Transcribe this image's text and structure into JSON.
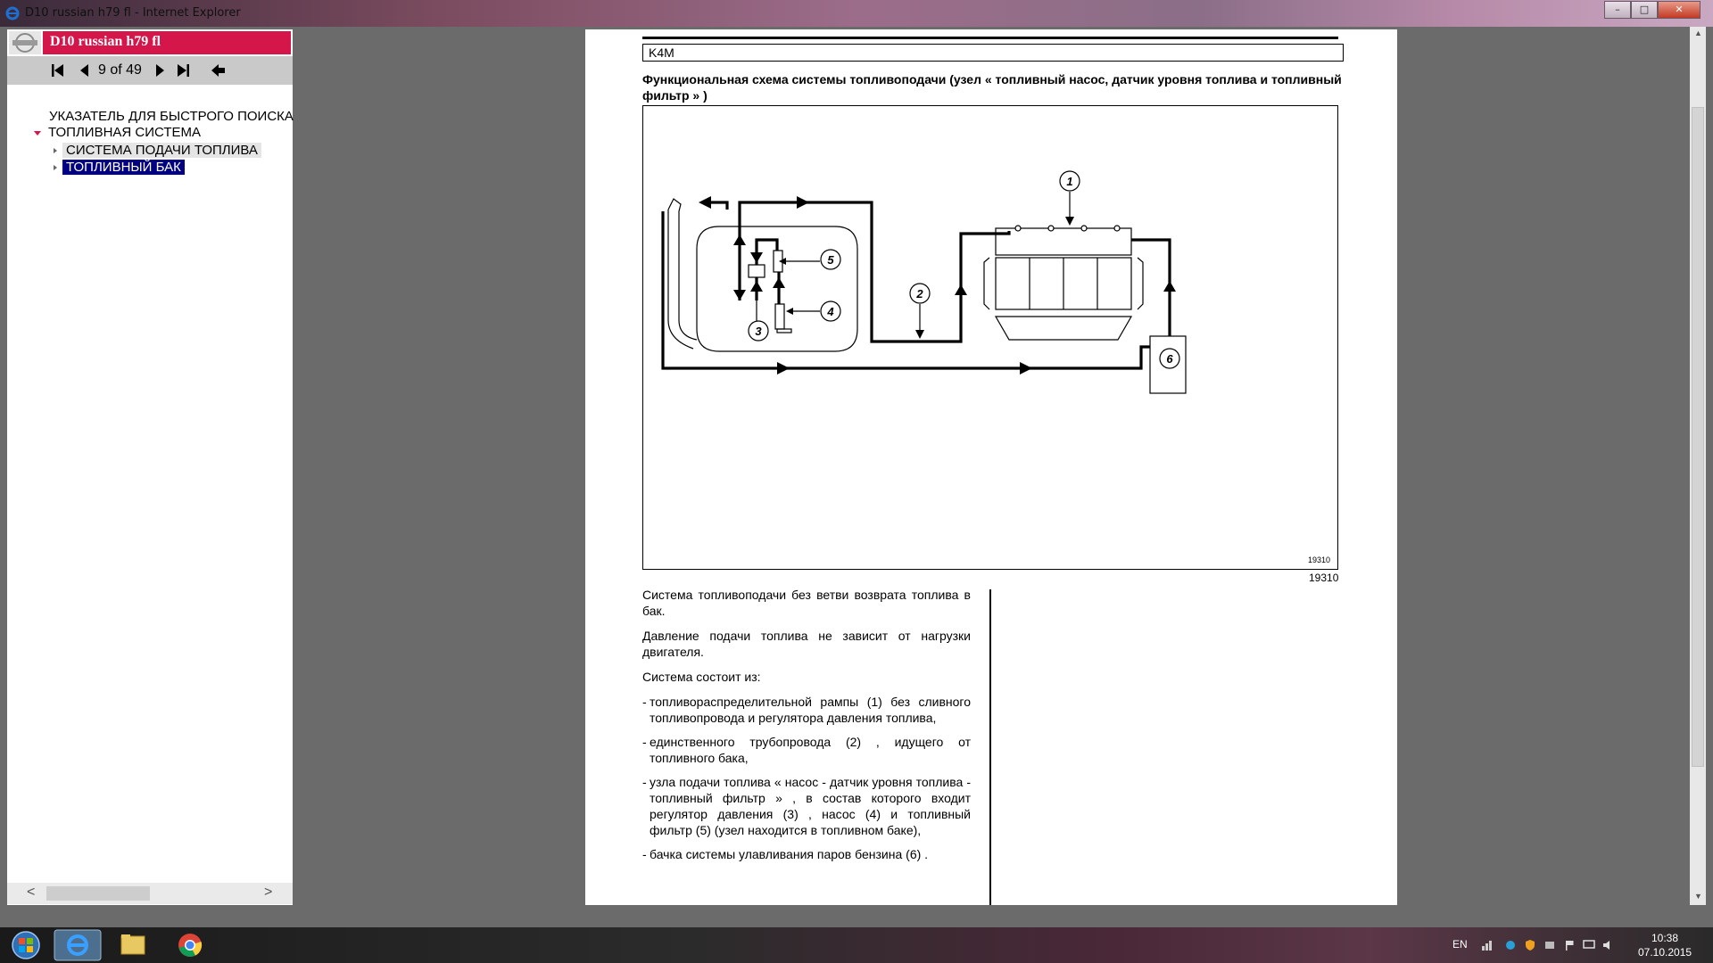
{
  "window": {
    "title": "D10 russian h79 fl - Internet Explorer"
  },
  "app": {
    "title": "D10 russian h79 fl",
    "pagination": {
      "current": 9,
      "total": 49,
      "label": "9 of 49"
    }
  },
  "toc": {
    "items": [
      {
        "label": "УКАЗАТЕЛЬ ДЛЯ БЫСТРОГО ПОИСКА",
        "level": 0
      },
      {
        "label": "ТОПЛИВНАЯ СИСТЕМА",
        "level": 0,
        "expanded": true
      },
      {
        "label": "СИСТЕМА ПОДАЧИ ТОПЛИВА",
        "level": 1,
        "state": "hover"
      },
      {
        "label": "ТОПЛИВНЫЙ БАК",
        "level": 1,
        "state": "selected"
      }
    ]
  },
  "document": {
    "engine_code": "K4M",
    "scheme_title": "Функциональная схема системы топливоподачи (узел « топливный насос, датчик уровня топлива и топливный фильтр » )",
    "figure_labels": [
      "1",
      "2",
      "3",
      "4",
      "5",
      "6"
    ],
    "figure_id_inner": "19310",
    "figure_id": "19310",
    "paragraphs": [
      "Система топливоподачи без ветви возврата топлива в бак.",
      "Давление подачи топлива не зависит от нагрузки двигателя.",
      "Система состоит из:"
    ],
    "list": [
      {
        "dash": "-",
        "text": "топливораспределительной рампы (1) без сливного топливопровода и регулятора давления топлива,"
      },
      {
        "dash": "-",
        "text": "единственного трубопровода (2) , идущего от топливного бака,"
      },
      {
        "dash": "-",
        "text": "узла подачи топлива « насос - датчик уровня топлива - топливный фильтр » , в состав которого входит регулятор давления (3) , насос (4) и топливный фильтр (5) (узел находится в топливном баке),"
      },
      {
        "dash": "-",
        "text": "бачка системы улавливания паров бензина (6) ."
      }
    ]
  },
  "taskbar": {
    "language": "EN",
    "time": "10:38",
    "date": "07.10.2015"
  },
  "colors": {
    "app_title_bg": "#d5164b",
    "selected_bg": "#000080",
    "hover_bg": "#e5e5e5"
  }
}
